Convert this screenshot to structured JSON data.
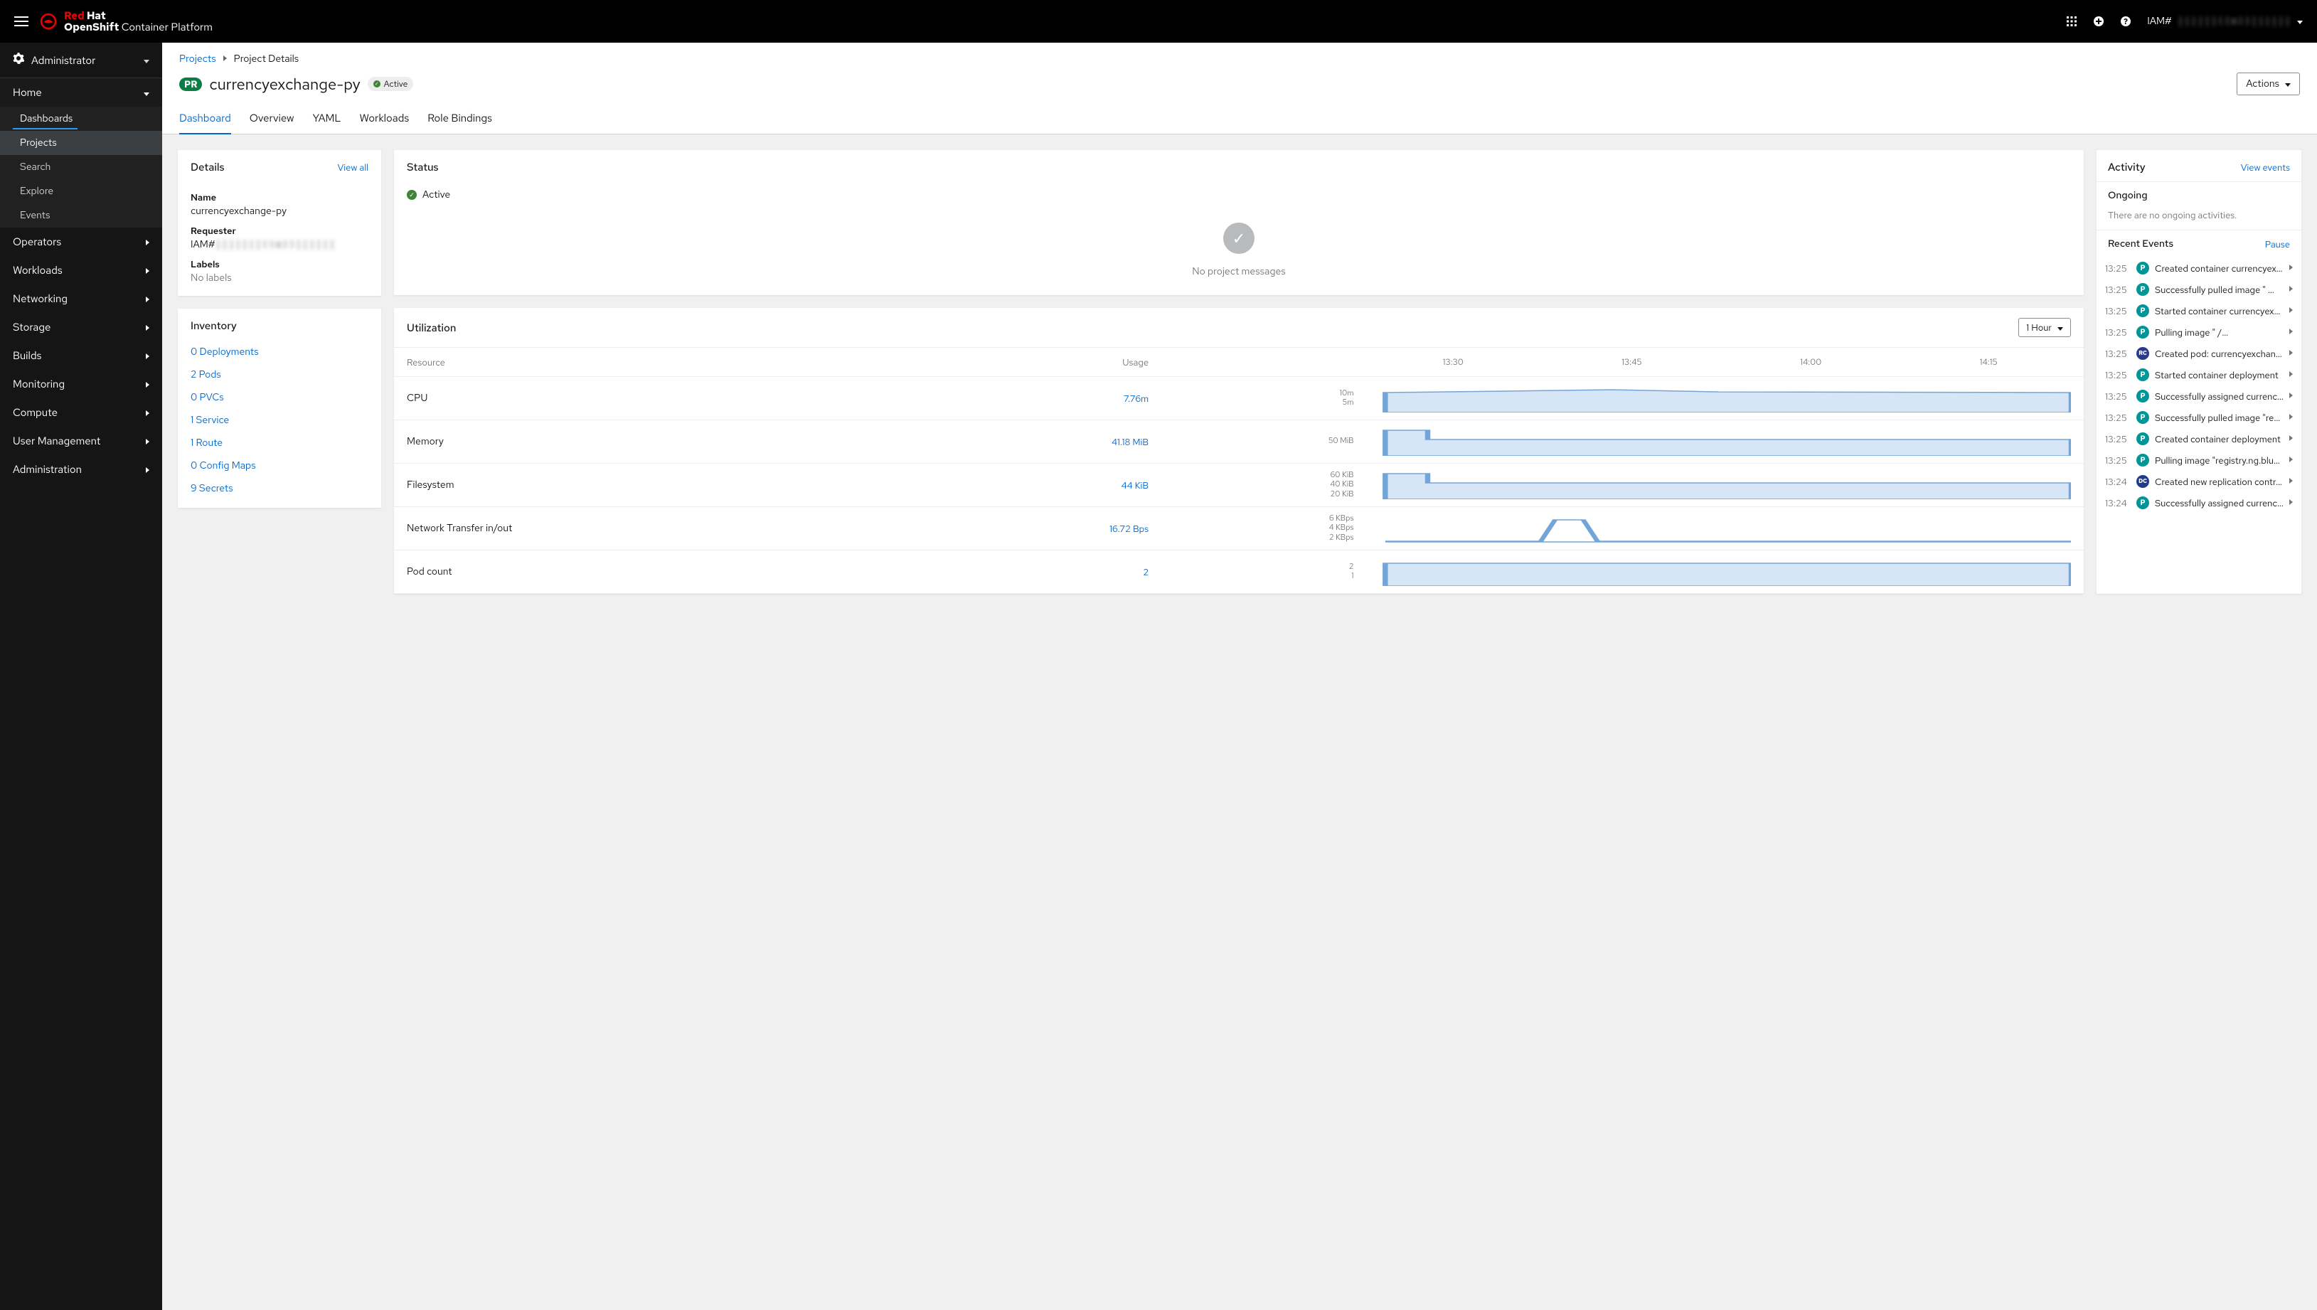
{
  "brand": {
    "line1a": "Red",
    "line1b": "Hat",
    "line2a": "OpenShift",
    "line2b": " Container Platform"
  },
  "topbar": {
    "user_prefix": "IAM#",
    "user_blur": "||||||((o))||||||"
  },
  "perspective": "Administrator",
  "nav": {
    "home": {
      "label": "Home",
      "items": [
        "Dashboards",
        "Projects",
        "Search",
        "Explore",
        "Events"
      ]
    },
    "sections": [
      "Operators",
      "Workloads",
      "Networking",
      "Storage",
      "Builds",
      "Monitoring",
      "Compute",
      "User Management",
      "Administration"
    ]
  },
  "breadcrumb": {
    "root": "Projects",
    "current": "Project Details"
  },
  "project": {
    "badge": "PR",
    "name": "currencyexchange-py",
    "status": "Active",
    "actions": "Actions"
  },
  "tabs": [
    "Dashboard",
    "Overview",
    "YAML",
    "Workloads",
    "Role Bindings"
  ],
  "details": {
    "title": "Details",
    "viewall": "View all",
    "name_label": "Name",
    "name_value": "currencyexchange-py",
    "requester_label": "Requester",
    "requester_prefix": "IAM#",
    "requester_blur": "|||||||((o))||||||",
    "labels_label": "Labels",
    "labels_value": "No labels"
  },
  "inventory": {
    "title": "Inventory",
    "items": [
      "0 Deployments",
      "2 Pods",
      "0 PVCs",
      "1 Service",
      "1 Route",
      "0 Config Maps",
      "9 Secrets"
    ]
  },
  "status": {
    "title": "Status",
    "state": "Active",
    "message": "No project messages"
  },
  "utilization": {
    "title": "Utilization",
    "duration": "1 Hour",
    "col_resource": "Resource",
    "col_usage": "Usage",
    "ticks": [
      "13:30",
      "13:45",
      "14:00",
      "14:15"
    ],
    "rows": [
      {
        "name": "CPU",
        "usage": "7.76m",
        "ylabels": "10m\n5m",
        "chart": "flat"
      },
      {
        "name": "Memory",
        "usage": "41.18 MiB",
        "ylabels": "50 MiB",
        "chart": "stepdown"
      },
      {
        "name": "Filesystem",
        "usage": "44 KiB",
        "ylabels": "60 KiB\n40 KiB\n20 KiB",
        "chart": "stepdown"
      },
      {
        "name": "Network Transfer in/out",
        "usage": "16.72 Bps",
        "ylabels": "6 KBps\n4 KBps\n2 KBps",
        "chart": "spike"
      },
      {
        "name": "Pod count",
        "usage": "2",
        "ylabels": "2\n1",
        "chart": "flat2"
      }
    ]
  },
  "activity": {
    "title": "Activity",
    "view_events": "View events",
    "ongoing_title": "Ongoing",
    "ongoing_msg": "There are no ongoing activities.",
    "recent_title": "Recent Events",
    "pause": "Pause",
    "events": [
      {
        "t": "13:25",
        "b": "P",
        "m": "Created container currencyexcha…"
      },
      {
        "t": "13:25",
        "b": "P",
        "m": "Successfully pulled image \"       …"
      },
      {
        "t": "13:25",
        "b": "P",
        "m": "Started container currencyexchan…"
      },
      {
        "t": "13:25",
        "b": "P",
        "m": "Pulling image \"                  /…"
      },
      {
        "t": "13:25",
        "b": "RC",
        "m": "Created pod: currencyexchange…"
      },
      {
        "t": "13:25",
        "b": "P",
        "m": "Started container deployment"
      },
      {
        "t": "13:25",
        "b": "P",
        "m": "Successfully assigned currencyex…"
      },
      {
        "t": "13:25",
        "b": "P",
        "m": "Successfully pulled image \"registr…"
      },
      {
        "t": "13:25",
        "b": "P",
        "m": "Created container deployment"
      },
      {
        "t": "13:25",
        "b": "P",
        "m": "Pulling image \"registry.ng.bluemix…"
      },
      {
        "t": "13:24",
        "b": "DC",
        "m": "Created new replication controll…"
      },
      {
        "t": "13:24",
        "b": "P",
        "m": "Successfully assigned currencyex…"
      }
    ]
  }
}
